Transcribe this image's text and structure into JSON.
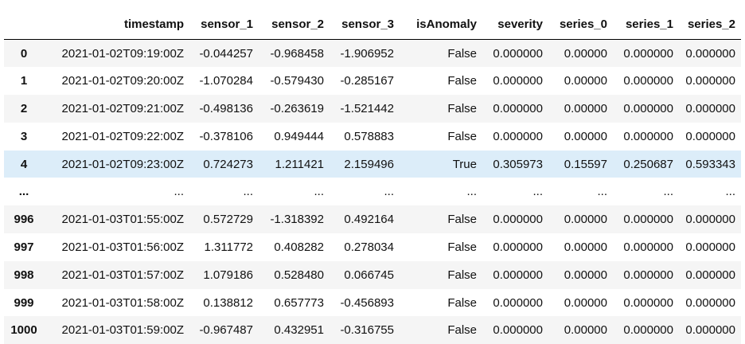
{
  "table": {
    "index_header": "",
    "columns": [
      "timestamp",
      "sensor_1",
      "sensor_2",
      "sensor_3",
      "isAnomaly",
      "severity",
      "series_0",
      "series_1",
      "series_2"
    ],
    "rows": [
      {
        "index": "0",
        "cells": [
          "2021-01-02T09:19:00Z",
          "-0.044257",
          "-0.968458",
          "-1.906952",
          "False",
          "0.000000",
          "0.00000",
          "0.000000",
          "0.000000"
        ]
      },
      {
        "index": "1",
        "cells": [
          "2021-01-02T09:20:00Z",
          "-1.070284",
          "-0.579430",
          "-0.285167",
          "False",
          "0.000000",
          "0.00000",
          "0.000000",
          "0.000000"
        ]
      },
      {
        "index": "2",
        "cells": [
          "2021-01-02T09:21:00Z",
          "-0.498136",
          "-0.263619",
          "-1.521442",
          "False",
          "0.000000",
          "0.00000",
          "0.000000",
          "0.000000"
        ]
      },
      {
        "index": "3",
        "cells": [
          "2021-01-02T09:22:00Z",
          "-0.378106",
          "0.949444",
          "0.578883",
          "False",
          "0.000000",
          "0.00000",
          "0.000000",
          "0.000000"
        ]
      },
      {
        "index": "4",
        "cells": [
          "2021-01-02T09:23:00Z",
          "0.724273",
          "1.211421",
          "2.159496",
          "True",
          "0.305973",
          "0.15597",
          "0.250687",
          "0.593343"
        ]
      },
      {
        "index": "...",
        "cells": [
          "...",
          "...",
          "...",
          "...",
          "...",
          "...",
          "...",
          "...",
          "..."
        ]
      },
      {
        "index": "996",
        "cells": [
          "2021-01-03T01:55:00Z",
          "0.572729",
          "-1.318392",
          "0.492164",
          "False",
          "0.000000",
          "0.00000",
          "0.000000",
          "0.000000"
        ]
      },
      {
        "index": "997",
        "cells": [
          "2021-01-03T01:56:00Z",
          "1.311772",
          "0.408282",
          "0.278034",
          "False",
          "0.000000",
          "0.00000",
          "0.000000",
          "0.000000"
        ]
      },
      {
        "index": "998",
        "cells": [
          "2021-01-03T01:57:00Z",
          "1.079186",
          "0.528480",
          "0.066745",
          "False",
          "0.000000",
          "0.00000",
          "0.000000",
          "0.000000"
        ]
      },
      {
        "index": "999",
        "cells": [
          "2021-01-03T01:58:00Z",
          "0.138812",
          "0.657773",
          "-0.456893",
          "False",
          "0.000000",
          "0.00000",
          "0.000000",
          "0.000000"
        ]
      },
      {
        "index": "1000",
        "cells": [
          "2021-01-03T01:59:00Z",
          "-0.967487",
          "0.432951",
          "-0.316755",
          "False",
          "0.000000",
          "0.00000",
          "0.000000",
          "0.000000"
        ]
      }
    ]
  },
  "colors": {
    "even_row": "#f5f5f5",
    "odd_row": "#ffffff",
    "hover_row": "#dcedf9",
    "header_rule": "#000000"
  },
  "hovered_row_index": "4"
}
